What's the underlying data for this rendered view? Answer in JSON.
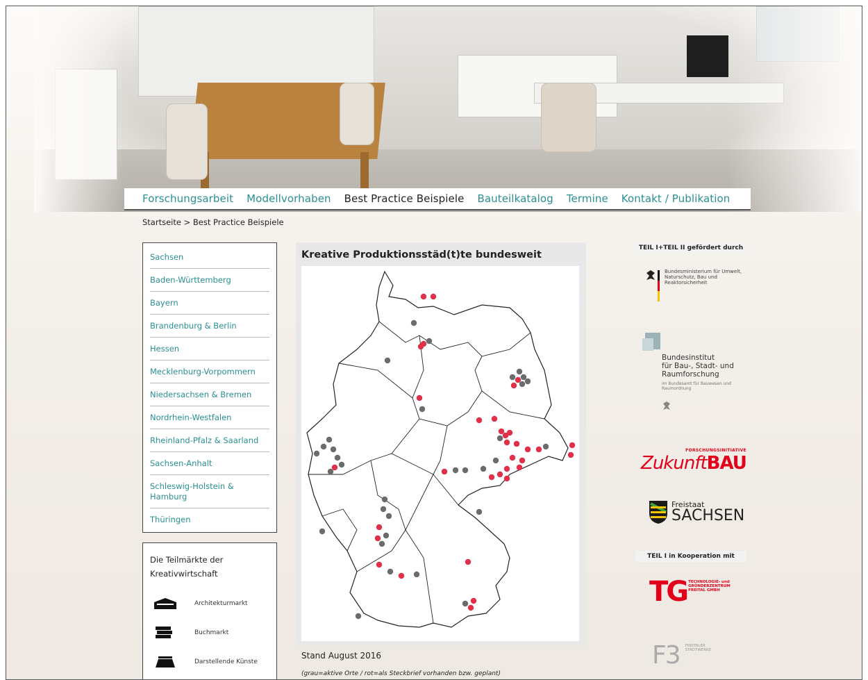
{
  "nav": {
    "items": [
      {
        "label": "Forschungsarbeit"
      },
      {
        "label": "Modellvorhaben"
      },
      {
        "label": "Best Practice Beispiele"
      },
      {
        "label": "Bauteilkatalog"
      },
      {
        "label": "Termine"
      },
      {
        "label": "Kontakt / Publikation"
      }
    ],
    "active_index": 2
  },
  "breadcrumb": "Startseite > Best Practice Beispiele",
  "regions": [
    "Sachsen",
    "Baden-Württemberg",
    "Bayern",
    "Brandenburg & Berlin",
    "Hessen",
    "Mecklenburg-Vorpommern",
    "Niedersachsen & Bremen",
    "Nordrhein-Westfalen",
    "Rheinland-Pfalz & Saarland",
    "Sachsen-Anhalt",
    "Schleswig-Holstein & Hamburg",
    "Thüringen"
  ],
  "markets": {
    "title": "Die Teilmärkte der Kreativwirtschaft",
    "items": [
      {
        "label": "Architekturmarkt",
        "icon": "architecture-icon"
      },
      {
        "label": "Buchmarkt",
        "icon": "books-icon"
      },
      {
        "label": "Darstellende Künste",
        "icon": "performing-arts-icon"
      }
    ]
  },
  "map": {
    "title": "Kreative Produktionsstäd(t)te bundesweit",
    "stand": "Stand August 2016",
    "note": "(grau=aktive Orte / rot=als Steckbrief vorhanden bzw. geplant)",
    "colors": {
      "active": "#6b6b6b",
      "profile": "#e0304a"
    }
  },
  "sponsors": {
    "header1": "TEIL I+TEIL II gefördert durch",
    "bmub": "Bundesministerium für Umwelt, Naturschutz, Bau und Reaktorsicherheit",
    "bbsr_1": "Bundesinstitut",
    "bbsr_2": "für Bau-, Stadt- und",
    "bbsr_3": "Raumforschung",
    "bbsr_small": "im Bundesamt für Bauwesen und Raumordnung",
    "zukunft_top": "FORSCHUNGSINITIATIVE",
    "zukunft_z": "Z",
    "zukunft_ukunft": "ukunft",
    "zukunft_bau": "BAU",
    "sachsen_small": "Freistaat",
    "sachsen_big": "SACHSEN",
    "header2": "TEIL I in Kooperation mit",
    "tg": "TG",
    "tg_text": "TECHNOLOGIE- und GRÜNDERZENTRUM FREITAL GMBH",
    "f3": "F3",
    "f3_text": "FREITALER STADTWERKE"
  }
}
